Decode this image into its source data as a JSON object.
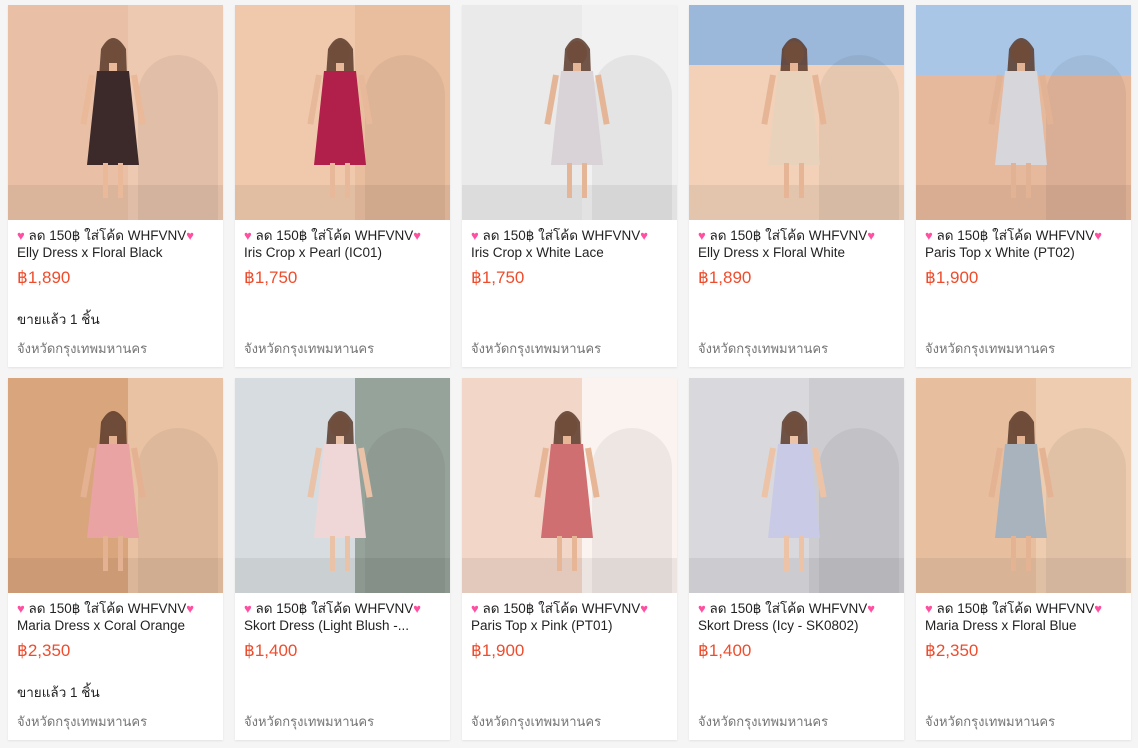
{
  "promo_prefix": "ลด 150฿ ใส่โค้ด WHFVNV",
  "heart_icon": "♥",
  "products": [
    {
      "name": "Elly Dress x Floral Black",
      "price": "฿1,890",
      "sold": "ขายแล้ว 1 ชิ้น",
      "location": "จังหวัดกรุงเทพมหานคร",
      "bg": "#e9c0a6",
      "wall": "#f0cdb6",
      "dress": "#3c2a2a",
      "skin": "#e9b999"
    },
    {
      "name": "Iris Crop x Pearl (IC01)",
      "price": "฿1,750",
      "sold": "",
      "location": "จังหวัดกรุงเทพมหานคร",
      "bg": "#f0c9ad",
      "wall": "#e6b999",
      "dress": "#b0204a",
      "skin": "#e7b89a"
    },
    {
      "name": "Iris Crop x White Lace",
      "price": "฿1,750",
      "sold": "",
      "location": "จังหวัดกรุงเทพมหานคร",
      "bg": "#eaeaea",
      "wall": "#f4f4f4",
      "dress": "#d9d2d6",
      "skin": "#e4b697"
    },
    {
      "name": "Elly Dress x Floral White",
      "price": "฿1,890",
      "sold": "",
      "location": "จังหวัดกรุงเทพมหานคร",
      "bg": "#f2d1b8",
      "wall": "#9bb7d9",
      "dress": "#e9d2bb",
      "skin": "#e6b596"
    },
    {
      "name": "Paris Top x White (PT02)",
      "price": "฿1,900",
      "sold": "",
      "location": "จังหวัดกรุงเทพมหานคร",
      "bg": "#e6b89c",
      "wall": "#a9c6e6",
      "dress": "#d7d6db",
      "skin": "#e2b294"
    },
    {
      "name": "Maria Dress x Coral Orange",
      "price": "฿2,350",
      "sold": "ขายแล้ว 1 ชิ้น",
      "location": "จังหวัดกรุงเทพมหานคร",
      "bg": "#d9a57d",
      "wall": "#f0cfb4",
      "dress": "#e9a3a3",
      "skin": "#e5b193"
    },
    {
      "name": "Skort Dress (Light Blush -...",
      "price": "฿1,400",
      "sold": "",
      "location": "จังหวัดกรุงเทพมหานคร",
      "bg": "#d7dce0",
      "wall": "#7a8a7c",
      "dress": "#efd7d7",
      "skin": "#e9c2a7"
    },
    {
      "name": "Paris Top x Pink (PT01)",
      "price": "฿1,900",
      "sold": "",
      "location": "จังหวัดกรุงเทพมหานคร",
      "bg": "#f2d6c8",
      "wall": "#ffffff",
      "dress": "#d06f72",
      "skin": "#e6b696"
    },
    {
      "name": "Skort Dress (Icy - SK0802)",
      "price": "฿1,400",
      "sold": "",
      "location": "จังหวัดกรุงเทพมหานคร",
      "bg": "#d9d9dd",
      "wall": "#c7c7cc",
      "dress": "#c9cbe6",
      "skin": "#ecc3a7"
    },
    {
      "name": "Maria Dress x Floral Blue",
      "price": "฿2,350",
      "sold": "",
      "location": "จังหวัดกรุงเทพมหานคร",
      "bg": "#e7bf9f",
      "wall": "#f0d1b7",
      "dress": "#a9b3bd",
      "skin": "#e4b394"
    }
  ]
}
